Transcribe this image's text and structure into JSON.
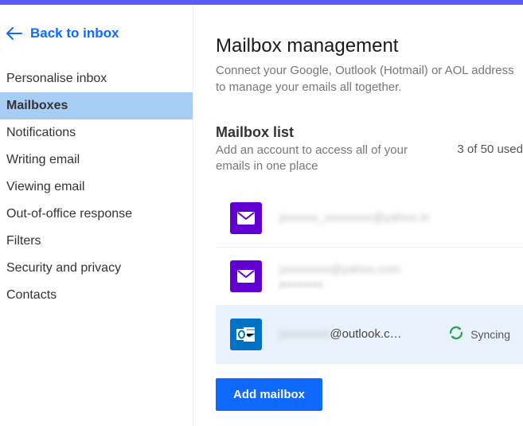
{
  "back_link": "Back to inbox",
  "sidebar": {
    "items": [
      {
        "label": "Personalise inbox",
        "active": false
      },
      {
        "label": "Mailboxes",
        "active": true
      },
      {
        "label": "Notifications",
        "active": false
      },
      {
        "label": "Writing email",
        "active": false
      },
      {
        "label": "Viewing email",
        "active": false
      },
      {
        "label": "Out-of-office response",
        "active": false
      },
      {
        "label": "Filters",
        "active": false
      },
      {
        "label": "Security and privacy",
        "active": false
      },
      {
        "label": "Contacts",
        "active": false
      }
    ]
  },
  "main": {
    "title": "Mailbox management",
    "description": "Connect your Google, Outlook (Hotmail) or AOL address to manage your emails all together.",
    "list_title": "Mailbox list",
    "list_subtitle": "Add an account to access all of your emails in one place",
    "used_count": "3 of 50 used",
    "mailboxes": [
      {
        "provider": "yahoo",
        "email_masked": "jxxxxxx_xxxxxxxx@yahoo.in",
        "sub_masked": ""
      },
      {
        "provider": "yahoo",
        "email_masked": "jxxxxxxxx@yahoo.com",
        "sub_masked": "jxxxxxxxx"
      },
      {
        "provider": "outlook",
        "email_prefix_masked": "jxxxxxxxx",
        "email_suffix": "@outlook.c…",
        "status": "Syncing"
      }
    ],
    "add_button": "Add mailbox"
  },
  "colors": {
    "accent": "#0f69ff",
    "yahoo_purple": "#6001d2",
    "outlook_blue": "#0072c6",
    "sync_green": "#2ea44f"
  }
}
